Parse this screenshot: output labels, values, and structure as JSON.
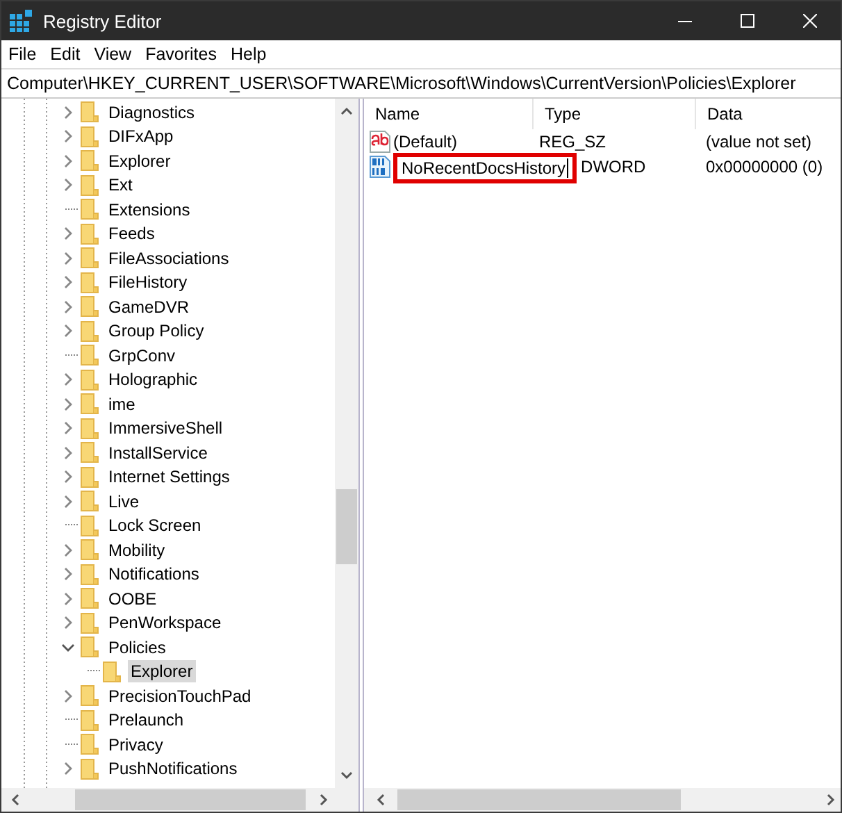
{
  "window": {
    "title": "Registry Editor"
  },
  "menu": [
    "File",
    "Edit",
    "View",
    "Favorites",
    "Help"
  ],
  "address": "Computer\\HKEY_CURRENT_USER\\SOFTWARE\\Microsoft\\Windows\\CurrentVersion\\Policies\\Explorer",
  "tree": {
    "items": [
      {
        "label": "Diagnostics",
        "expandable": true,
        "expanded": false,
        "selected": false
      },
      {
        "label": "DIFxApp",
        "expandable": true,
        "expanded": false,
        "selected": false
      },
      {
        "label": "Explorer",
        "expandable": true,
        "expanded": false,
        "selected": false
      },
      {
        "label": "Ext",
        "expandable": true,
        "expanded": false,
        "selected": false
      },
      {
        "label": "Extensions",
        "expandable": false,
        "selected": false
      },
      {
        "label": "Feeds",
        "expandable": true,
        "expanded": false,
        "selected": false
      },
      {
        "label": "FileAssociations",
        "expandable": true,
        "expanded": false,
        "selected": false
      },
      {
        "label": "FileHistory",
        "expandable": true,
        "expanded": false,
        "selected": false
      },
      {
        "label": "GameDVR",
        "expandable": true,
        "expanded": false,
        "selected": false
      },
      {
        "label": "Group Policy",
        "expandable": true,
        "expanded": false,
        "selected": false
      },
      {
        "label": "GrpConv",
        "expandable": false,
        "selected": false
      },
      {
        "label": "Holographic",
        "expandable": true,
        "expanded": false,
        "selected": false
      },
      {
        "label": "ime",
        "expandable": true,
        "expanded": false,
        "selected": false
      },
      {
        "label": "ImmersiveShell",
        "expandable": true,
        "expanded": false,
        "selected": false
      },
      {
        "label": "InstallService",
        "expandable": true,
        "expanded": false,
        "selected": false
      },
      {
        "label": "Internet Settings",
        "expandable": true,
        "expanded": false,
        "selected": false
      },
      {
        "label": "Live",
        "expandable": true,
        "expanded": false,
        "selected": false
      },
      {
        "label": "Lock Screen",
        "expandable": false,
        "selected": false
      },
      {
        "label": "Mobility",
        "expandable": true,
        "expanded": false,
        "selected": false
      },
      {
        "label": "Notifications",
        "expandable": true,
        "expanded": false,
        "selected": false
      },
      {
        "label": "OOBE",
        "expandable": true,
        "expanded": false,
        "selected": false
      },
      {
        "label": "PenWorkspace",
        "expandable": true,
        "expanded": false,
        "selected": false
      },
      {
        "label": "Policies",
        "expandable": true,
        "expanded": true,
        "selected": false,
        "children": [
          {
            "label": "Explorer",
            "expandable": false,
            "selected": true
          }
        ]
      },
      {
        "label": "PrecisionTouchPad",
        "expandable": true,
        "expanded": false,
        "selected": false
      },
      {
        "label": "Prelaunch",
        "expandable": false,
        "selected": false
      },
      {
        "label": "Privacy",
        "expandable": false,
        "selected": false
      },
      {
        "label": "PushNotifications",
        "expandable": true,
        "expanded": false,
        "selected": false
      }
    ]
  },
  "values": {
    "columns": [
      "Name",
      "Type",
      "Data"
    ],
    "rows": [
      {
        "kind": "string",
        "name": "(Default)",
        "type": "REG_SZ",
        "data": "(value not set)",
        "renaming": false
      },
      {
        "kind": "dword",
        "name": "NoRecentDocsHistory",
        "type": "DWORD",
        "data": "0x00000000 (0)",
        "renaming": true
      }
    ]
  }
}
